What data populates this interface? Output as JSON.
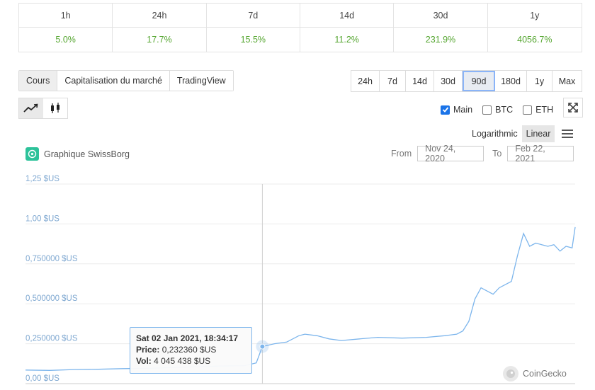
{
  "performance": {
    "headers": [
      "1h",
      "24h",
      "7d",
      "14d",
      "30d",
      "1y"
    ],
    "values": [
      "5.0%",
      "17.7%",
      "15.5%",
      "11.2%",
      "231.9%",
      "4056.7%"
    ],
    "positive_color": "#55a630"
  },
  "tabs": [
    {
      "label": "Cours",
      "active": true
    },
    {
      "label": "Capitalisation du marché",
      "active": false
    },
    {
      "label": "TradingView",
      "active": false
    }
  ],
  "ranges": [
    {
      "label": "24h",
      "active": false
    },
    {
      "label": "7d",
      "active": false
    },
    {
      "label": "14d",
      "active": false
    },
    {
      "label": "30d",
      "active": false
    },
    {
      "label": "90d",
      "active": true
    },
    {
      "label": "180d",
      "active": false
    },
    {
      "label": "1y",
      "active": false
    },
    {
      "label": "Max",
      "active": false
    }
  ],
  "chart_types": [
    {
      "icon": "line-chart-icon",
      "active": true
    },
    {
      "icon": "candlestick-icon",
      "active": false
    }
  ],
  "compare": [
    {
      "label": "Main",
      "checked": true
    },
    {
      "label": "BTC",
      "checked": false
    },
    {
      "label": "ETH",
      "checked": false
    }
  ],
  "scale": {
    "logarithmic": "Logarithmic",
    "linear": "Linear",
    "active": "linear"
  },
  "chart_title": "Graphique SwissBorg",
  "date_range": {
    "from_label": "From",
    "from_value": "Nov 24, 2020",
    "to_label": "To",
    "to_value": "Feb 22, 2021"
  },
  "tooltip": {
    "date": "Sat 02 Jan 2021, 18:34:17",
    "price_label": "Price:",
    "price_value": "0,232360 $US",
    "vol_label": "Vol:",
    "vol_value": "4 045 438 $US"
  },
  "credit": "CoinGecko",
  "chart_data": {
    "type": "line",
    "title": "Graphique SwissBorg",
    "y_tick_labels": [
      "0,00 $US",
      "0,250000 $US",
      "0,500000 $US",
      "0,750000 $US",
      "1,00 $US",
      "1,25 $US"
    ],
    "y_ticks": [
      0,
      0.25,
      0.5,
      0.75,
      1.0,
      1.25
    ],
    "ylim": [
      0,
      1.25
    ],
    "xlim": [
      "2020-11-24",
      "2021-02-22"
    ],
    "series": [
      {
        "name": "Main",
        "color": "#7cb5ec",
        "points": [
          [
            "2020-11-24",
            0.085
          ],
          [
            "2020-11-28",
            0.083
          ],
          [
            "2020-12-02",
            0.088
          ],
          [
            "2020-12-06",
            0.09
          ],
          [
            "2020-12-10",
            0.094
          ],
          [
            "2020-12-14",
            0.096
          ],
          [
            "2020-12-18",
            0.1
          ],
          [
            "2020-12-22",
            0.106
          ],
          [
            "2020-12-26",
            0.11
          ],
          [
            "2020-12-30",
            0.112
          ],
          [
            "2021-01-01",
            0.13
          ],
          [
            "2021-01-02",
            0.23236
          ],
          [
            "2021-01-04",
            0.25
          ],
          [
            "2021-01-06",
            0.26
          ],
          [
            "2021-01-08",
            0.3
          ],
          [
            "2021-01-09",
            0.31
          ],
          [
            "2021-01-11",
            0.3
          ],
          [
            "2021-01-13",
            0.28
          ],
          [
            "2021-01-15",
            0.27
          ],
          [
            "2021-01-18",
            0.28
          ],
          [
            "2021-01-21",
            0.29
          ],
          [
            "2021-01-25",
            0.285
          ],
          [
            "2021-01-29",
            0.29
          ],
          [
            "2021-02-01",
            0.3
          ],
          [
            "2021-02-03",
            0.31
          ],
          [
            "2021-02-04",
            0.33
          ],
          [
            "2021-02-05",
            0.39
          ],
          [
            "2021-02-06",
            0.53
          ],
          [
            "2021-02-07",
            0.6
          ],
          [
            "2021-02-08",
            0.58
          ],
          [
            "2021-02-09",
            0.56
          ],
          [
            "2021-02-10",
            0.6
          ],
          [
            "2021-02-11",
            0.62
          ],
          [
            "2021-02-12",
            0.64
          ],
          [
            "2021-02-13",
            0.8
          ],
          [
            "2021-02-14",
            0.94
          ],
          [
            "2021-02-15",
            0.86
          ],
          [
            "2021-02-16",
            0.88
          ],
          [
            "2021-02-17",
            0.87
          ],
          [
            "2021-02-18",
            0.86
          ],
          [
            "2021-02-19",
            0.87
          ],
          [
            "2021-02-20",
            0.83
          ],
          [
            "2021-02-21",
            0.86
          ],
          [
            "2021-02-22",
            0.85
          ],
          [
            "2021-02-22T12:00",
            0.98
          ]
        ]
      }
    ],
    "highlight": {
      "x": "2021-01-02",
      "y": 0.23236
    },
    "grid": true,
    "legend": "none"
  }
}
